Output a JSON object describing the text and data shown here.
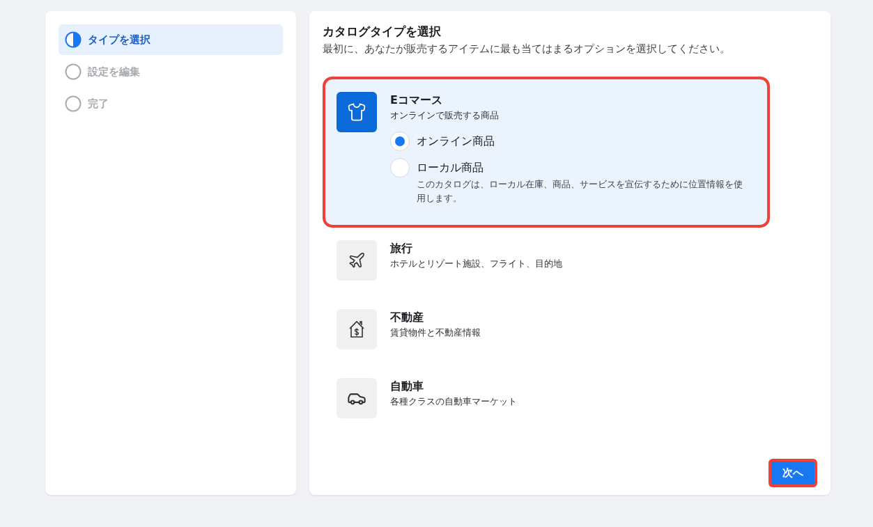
{
  "steps": [
    {
      "label": "タイプを選択",
      "kind": "current",
      "selected": true
    },
    {
      "label": "設定を編集",
      "kind": "pending",
      "selected": false
    },
    {
      "label": "完了",
      "kind": "pending",
      "selected": false
    }
  ],
  "header": {
    "title": "カタログタイプを選択",
    "subtitle": "最初に、あなたが販売するアイテムに最も当てはまるオプションを選択してください。"
  },
  "catalog_types": [
    {
      "kind": "shirt",
      "title": "Eコマース",
      "description": "オンラインで販売する商品",
      "selected": true,
      "highlighted": true,
      "options": [
        {
          "label": "オンライン商品",
          "selected": true
        },
        {
          "label": "ローカル商品",
          "selected": false,
          "description": "このカタログは、ローカル在庫、商品、サービスを宣伝するために位置情報を使用します。"
        }
      ]
    },
    {
      "kind": "plane",
      "title": "旅行",
      "description": "ホテルとリゾート施設、フライト、目的地",
      "selected": false,
      "highlighted": false
    },
    {
      "kind": "house",
      "title": "不動産",
      "description": "賃貸物件と不動産情報",
      "selected": false,
      "highlighted": false
    },
    {
      "kind": "car",
      "title": "自動車",
      "description": "各種クラスの自動車マーケット",
      "selected": false,
      "highlighted": false
    }
  ],
  "next_button": {
    "label": "次へ",
    "highlighted": true
  }
}
